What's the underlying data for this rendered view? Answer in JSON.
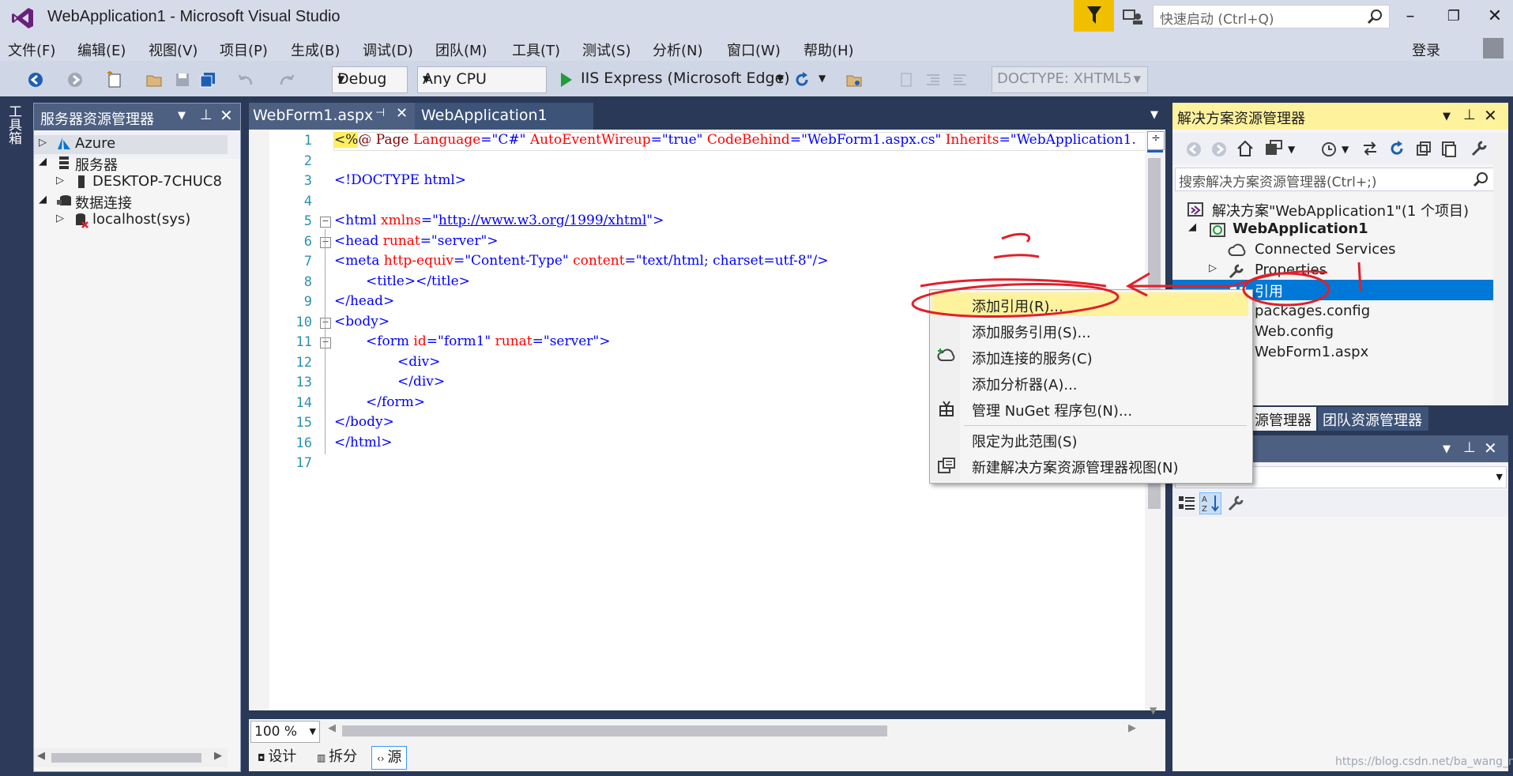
{
  "window": {
    "title": "WebApplication1 - Microsoft Visual Studio",
    "quick_launch_placeholder": "快速启动 (Ctrl+Q)",
    "login": "登录"
  },
  "menu": [
    "文件(F)",
    "编辑(E)",
    "视图(V)",
    "项目(P)",
    "生成(B)",
    "调试(D)",
    "团队(M)",
    "工具(T)",
    "测试(S)",
    "分析(N)",
    "窗口(W)",
    "帮助(H)"
  ],
  "toolbar": {
    "config": "Debug",
    "platform": "Any CPU",
    "run_label": "IIS Express (Microsoft Edge)",
    "doctype": "DOCTYPE: XHTML5"
  },
  "left_strip": {
    "toolbox": "工具箱"
  },
  "server_explorer": {
    "title": "服务器资源管理器",
    "items": [
      {
        "label": "Azure"
      },
      {
        "label": "服务器"
      },
      {
        "label": "DESKTOP-7CHUC8"
      },
      {
        "label": "数据连接"
      },
      {
        "label": "localhost(sys)"
      }
    ]
  },
  "editor": {
    "tabs": [
      {
        "label": "WebForm1.aspx"
      },
      {
        "label": "WebApplication1"
      }
    ],
    "line_numbers": [
      "1",
      "2",
      "3",
      "4",
      "5",
      "6",
      "7",
      "8",
      "9",
      "10",
      "11",
      "12",
      "13",
      "14",
      "15",
      "16",
      "17"
    ],
    "lines": {
      "l1a": "<%",
      "l1b": "@ Page ",
      "l1c": "Language",
      "l1d": "=\"C#\" ",
      "l1e": "AutoEventWireup",
      "l1f": "=\"true\" ",
      "l1g": "CodeBehind",
      "l1h": "=\"WebForm1.aspx.cs\" ",
      "l1i": "Inherits",
      "l1j": "=\"WebApplication1.",
      "l3": "<!DOCTYPE html>",
      "l5a": "<html ",
      "l5b": "xmlns",
      "l5c": "=\"",
      "l5d": "http://www.w3.org/1999/xhtml",
      "l5e": "\">",
      "l6a": "<head ",
      "l6b": "runat",
      "l6c": "=\"server\">",
      "l7a": "<meta ",
      "l7b": "http-equiv",
      "l7c": "=\"Content-Type\" ",
      "l7d": "content",
      "l7e": "=\"text/html; charset=utf-8\"/>",
      "l8": "<title></title>",
      "l9": "</head>",
      "l10": "<body>",
      "l11a": "<form ",
      "l11b": "id",
      "l11c": "=\"form1\" ",
      "l11d": "runat",
      "l11e": "=\"server\">",
      "l12": "<div>",
      "l13": "</div>",
      "l14": "</form>",
      "l15": "</body>",
      "l16": "</html>"
    },
    "zoom": "100 %",
    "view_tabs": [
      {
        "label": "设计"
      },
      {
        "label": "拆分"
      },
      {
        "label": "源"
      }
    ]
  },
  "solution_explorer": {
    "title": "解决方案资源管理器",
    "search_placeholder": "搜索解决方案资源管理器(Ctrl+;)",
    "items": [
      {
        "label": "解决方案\"WebApplication1\"(1 个项目)"
      },
      {
        "label": "WebApplication1"
      },
      {
        "label": "Connected Services"
      },
      {
        "label": "Properties"
      },
      {
        "label": "引用"
      },
      {
        "label": "packages.config"
      },
      {
        "label": "Web.config"
      },
      {
        "label": "WebForm1.aspx"
      }
    ],
    "bottom_tabs": [
      {
        "label": "源管理器"
      },
      {
        "label": "团队资源管理器"
      }
    ]
  },
  "context_menu": {
    "items": [
      {
        "label": "添加引用(R)..."
      },
      {
        "label": "添加服务引用(S)..."
      },
      {
        "label": "添加连接的服务(C)"
      },
      {
        "label": "添加分析器(A)..."
      },
      {
        "label": "管理 NuGet 程序包(N)..."
      },
      {
        "label": "限定为此范围(S)"
      },
      {
        "label": "新建解决方案资源管理器视图(N)"
      }
    ]
  },
  "annotations": {
    "n1": "1",
    "n2": "2"
  },
  "watermark": "https://blog.csdn.net/ba_wang_mao",
  "colors": {
    "title_bg": "#d6dbe9",
    "dark_bg": "#293957",
    "selection": "#0078d7",
    "highlight": "#fff29d",
    "annotation": "#e0202a"
  }
}
